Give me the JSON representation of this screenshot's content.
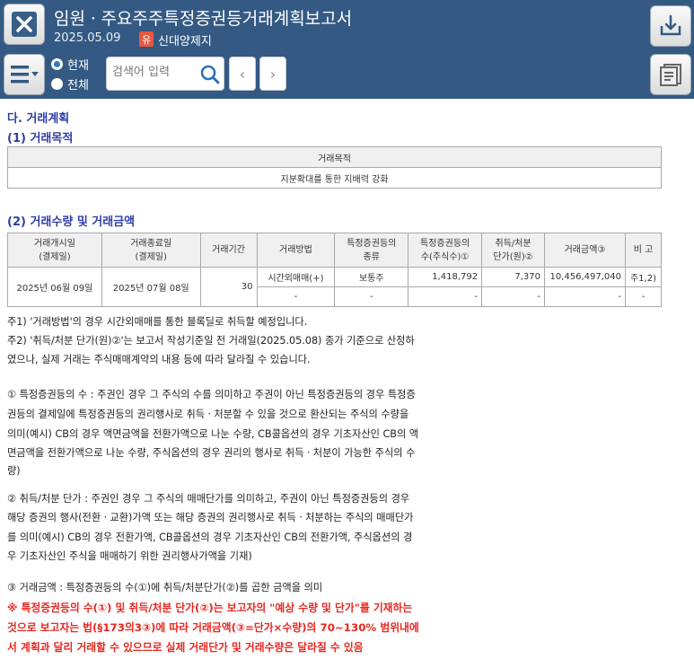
{
  "header": {
    "title": "임원ㆍ주요주주특정증권등거래계획보고서",
    "date": "2025.05.09",
    "badge": "유",
    "market": "신대양제지",
    "radio_current": "현재",
    "radio_all": "전체",
    "search_placeholder": "검색어 입력",
    "prev": "‹",
    "next": "›"
  },
  "section": {
    "heading": "다. 거래계획",
    "purpose_heading": "(1) 거래목적",
    "purpose_col": "거래목적",
    "purpose_value": "지분확대를 통한 지배력 강화",
    "volume_heading": "(2) 거래수량 및 거래금액"
  },
  "table": {
    "headers": [
      [
        "거래개시일",
        "(결제일)"
      ],
      [
        "거래종료일",
        "(결제일)"
      ],
      [
        "거래기간",
        ""
      ],
      [
        "거래방법",
        ""
      ],
      [
        "특정증권등의",
        "종류"
      ],
      [
        "특정증권등의",
        "수(주식수)①"
      ],
      [
        "취득/처분",
        "단가(원)②"
      ],
      [
        "거래금액③",
        ""
      ],
      [
        "비 고",
        ""
      ]
    ],
    "start_date": "2025년 06월 09일",
    "end_date": "2025년 07월 08일",
    "period": "30",
    "rows": [
      {
        "method": "시간외매매(+)",
        "kind": "보통주",
        "qty": "1,418,792",
        "price": "7,370",
        "amount": "10,456,497,040",
        "note": "주1,2)"
      },
      {
        "method": "-",
        "kind": "-",
        "qty": "-",
        "price": "-",
        "amount": "-",
        "note": "-"
      }
    ]
  },
  "notes": {
    "n1": "주1) '거래방법'의 경우 시간외매매를 통한 블록딜로 취득할 예정입니다.",
    "n2a": "주2) '취득/처분 단가(원)②'는 보고서 작성기준일 전 거래일(2025.05.08) 종가 기준으로 산정하",
    "n2b": "였으나, 실제 거래는 주식매매계약의 내용 등에 따라 달라질 수 있습니다.",
    "c1a": "① 특정증권등의 수 : 주권인 경우 그 주식의 수를 의미하고 주권이 아닌 특정증권등의 경우 특정증",
    "c1b": "권등의 결제일에 특정증권등의 권리행사로 취득ㆍ처분할 수 있을 것으로 환산되는 주식의 수량을",
    "c1c": "의미(예시) CB의 경우 액면금액을 전환가액으로 나눈 수량, CB콜옵션의 경우 기초자산인 CB의 액",
    "c1d": "면금액을 전환가액으로 나눈 수량, 주식옵션의 경우 권리의 행사로 취득ㆍ처분이 가능한 주식의 수",
    "c1e": "량)",
    "c2a": "② 취득/처분 단가 : 주권인 경우 그 주식의 매매단가를 의미하고, 주권이 아닌 특정증권등의 경우",
    "c2b": "해당 증권의 행사(전환ㆍ교환)가액 또는 해당 증권의 권리행사로 취득ㆍ처분하는 주식의 매매단가",
    "c2c": "를 의미(예시) CB의 경우 전환가액, CB콜옵션의 경우 기초자산인 CB의 전환가액, 주식옵션의 경",
    "c2d": "우 기초자산인 주식을 매매하기 위한 권리행사가액을 기재)",
    "c3": "③ 거래금액 : 특정증권등의 수(①)에 취득/처분단가(②)를 곱한 금액을 의미",
    "warn1": "※ 특정증권등의 수(①) 및 취득/처분 단가(②)는 보고자의 \"예상 수량 및 단가\"를 기재하는",
    "warn2": "것으로 보고자는 법(§173의3③)에 따라 거래금액(③=단가×수량)의 70~130% 범위내에",
    "warn3": "서 계획과 달리 거래할 수 있으므로 실제 거래단가 및 거래수량은 달라질 수 있음"
  },
  "colors": {
    "header_bg": "#345a83",
    "heading_blue": "#2f3ea8",
    "warning_red": "#e8271f",
    "badge_red": "#e9573f"
  }
}
